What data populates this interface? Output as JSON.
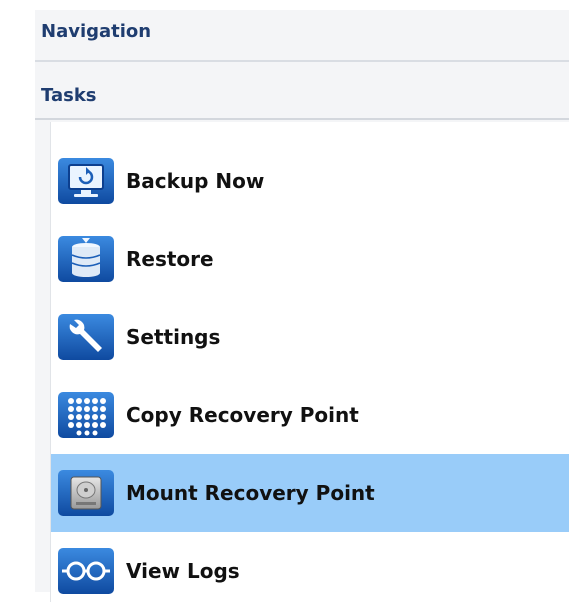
{
  "navigation": {
    "title": "Navigation"
  },
  "tasks": {
    "title": "Tasks",
    "items": [
      {
        "label": "Backup Now",
        "icon": "monitor-backup-icon",
        "selected": false
      },
      {
        "label": "Restore",
        "icon": "database-stack-icon",
        "selected": false
      },
      {
        "label": "Settings",
        "icon": "wrench-icon",
        "selected": false
      },
      {
        "label": "Copy Recovery Point",
        "icon": "dot-grid-icon",
        "selected": false
      },
      {
        "label": "Mount Recovery Point",
        "icon": "hard-drive-icon",
        "selected": true
      },
      {
        "label": "View Logs",
        "icon": "glasses-icon",
        "selected": false
      }
    ]
  },
  "colors": {
    "header_text": "#1f3d70",
    "selected_bg": "#99ccf9",
    "icon_blue": "#1c5fb8"
  }
}
